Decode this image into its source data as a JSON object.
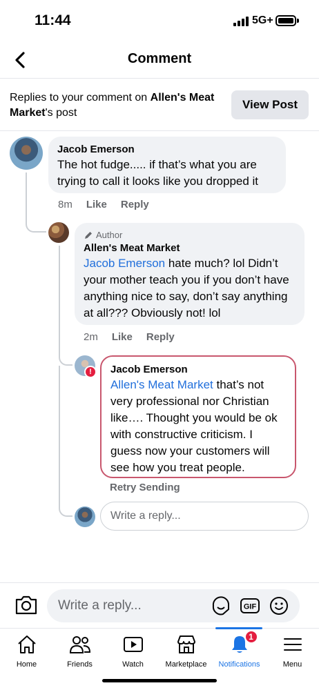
{
  "status_bar": {
    "time": "11:44",
    "network": "5G+"
  },
  "header": {
    "title": "Comment"
  },
  "context": {
    "prefix": "Replies to your comment on ",
    "page_name": "Allen's Meat Market",
    "suffix": "'s post",
    "view_post_label": "View Post"
  },
  "comments": [
    {
      "author": "Jacob Emerson",
      "text": "The hot fudge..... if that’s what you are trying to call it looks like you dropped it",
      "time": "8m",
      "like_label": "Like",
      "reply_label": "Reply"
    },
    {
      "author_tag": "Author",
      "author": "Allen's Meat Market",
      "mention": "Jacob Emerson",
      "text": " hate much?  lol Didn’t your mother teach you if you don’t have anything nice to say, don’t say anything at all???  Obviously not!  lol",
      "time": "2m",
      "like_label": "Like",
      "reply_label": "Reply"
    },
    {
      "author": "Jacob Emerson",
      "mention": "Allen's Meat Market",
      "text": "  that’s not very professional nor Christian like…. Thought you would be ok with constructive criticism. I guess now your customers will see how you treat people.",
      "status": "Retry Sending",
      "error_badge": "!"
    }
  ],
  "inline_reply": {
    "placeholder": "Write a reply..."
  },
  "composer": {
    "placeholder": "Write a reply...",
    "gif_label": "GIF"
  },
  "tabs": [
    {
      "label": "Home",
      "icon": "home-icon"
    },
    {
      "label": "Friends",
      "icon": "friends-icon"
    },
    {
      "label": "Watch",
      "icon": "watch-icon"
    },
    {
      "label": "Marketplace",
      "icon": "marketplace-icon"
    },
    {
      "label": "Notifications",
      "icon": "bell-icon",
      "badge": "1",
      "active": true
    },
    {
      "label": "Menu",
      "icon": "menu-icon"
    }
  ],
  "colors": {
    "accent": "#1b74e4",
    "mention": "#216fdb",
    "error": "#e41e3f",
    "bubble": "#f0f2f5"
  }
}
